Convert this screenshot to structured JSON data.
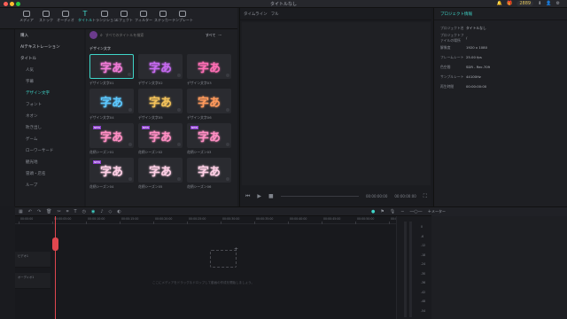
{
  "window": {
    "title": "タイトルなし"
  },
  "topbar_right": {
    "points": "2889",
    "items": [
      "🔔",
      "🎁",
      "⬇",
      "👤",
      "⚙"
    ]
  },
  "nav_tabs": [
    {
      "label": "メディア",
      "icon": "media-icon"
    },
    {
      "label": "ストック",
      "icon": "stock-icon"
    },
    {
      "label": "オーディオ",
      "icon": "audio-icon"
    },
    {
      "label": "タイトル",
      "icon": "title-icon",
      "active": true
    },
    {
      "label": "トランジション",
      "icon": "transition-icon"
    },
    {
      "label": "エフェクト",
      "icon": "effect-icon"
    },
    {
      "label": "フィルター",
      "icon": "filter-icon"
    },
    {
      "label": "ステッカー",
      "icon": "sticker-icon"
    },
    {
      "label": "テンプレート",
      "icon": "template-icon"
    }
  ],
  "sidebar": {
    "items": [
      {
        "label": "購入",
        "level": "top"
      },
      {
        "label": "AIテキストレーション",
        "level": "top"
      },
      {
        "label": "タイトル",
        "level": "top"
      },
      {
        "label": "人気",
        "level": "sub"
      },
      {
        "label": "字幕",
        "level": "sub"
      },
      {
        "label": "デザイン文字",
        "level": "sub",
        "active": true
      },
      {
        "label": "フォント",
        "level": "sub"
      },
      {
        "label": "ネオン",
        "level": "sub"
      },
      {
        "label": "吹き出し",
        "level": "sub"
      },
      {
        "label": "ゲーム",
        "level": "sub"
      },
      {
        "label": "ローワーサード",
        "level": "sub"
      },
      {
        "label": "観光地",
        "level": "sub"
      },
      {
        "label": "冒頭・店名",
        "level": "sub"
      },
      {
        "label": "ループ",
        "level": "sub"
      }
    ]
  },
  "gallery": {
    "search_placeholder": "すべてのタイトルを検索",
    "filter_label": "すべて",
    "more_label": "···",
    "section_title": "デザイン文字",
    "items": [
      {
        "glyph": "字あ",
        "color": "#f07bd6",
        "caption": "デザイン文字01",
        "selected": true
      },
      {
        "glyph": "字あ",
        "color": "#c66af0",
        "caption": "デザイン文字02"
      },
      {
        "glyph": "字あ",
        "color": "#ff6fb5",
        "caption": "デザイン文字03"
      },
      {
        "glyph": "字あ",
        "color": "#5cc8ff",
        "caption": "デザイン文字04"
      },
      {
        "glyph": "字あ",
        "color": "#f3c25a",
        "caption": "デザイン文字05"
      },
      {
        "glyph": "字あ",
        "color": "#ff9a5c",
        "caption": "デザイン文字06"
      },
      {
        "glyph": "字あ",
        "color": "#ff8fc4",
        "caption": "花柄シーズン01",
        "badge": "NEW"
      },
      {
        "glyph": "字あ",
        "color": "#ff8fc4",
        "caption": "花柄シーズン02",
        "badge": "NEW"
      },
      {
        "glyph": "字あ",
        "color": "#ff8fc4",
        "caption": "花柄シーズン03",
        "badge": "NEW"
      },
      {
        "glyph": "字あ",
        "color": "#ffd0e6",
        "caption": "花柄シーズン04",
        "badge": "NEW"
      },
      {
        "glyph": "字あ",
        "color": "#ffd0e6",
        "caption": "花柄シーズン05"
      },
      {
        "glyph": "字あ",
        "color": "#ffd0e6",
        "caption": "花柄シーズン06"
      }
    ]
  },
  "preview": {
    "tab_player": "タイムライン",
    "tab_quality": "フル",
    "time_current": "00:00:00:00",
    "time_total": "00:00:00:00"
  },
  "properties": {
    "tab": "プロジェクト情報",
    "rows": [
      {
        "k": "プロジェクト名",
        "v": "タイトルなし"
      },
      {
        "k": "プロジェクトファイルの場所",
        "v": "/"
      },
      {
        "k": "解像度",
        "v": "1920 x 1080"
      },
      {
        "k": "フレームレート",
        "v": "25.00 fps"
      },
      {
        "k": "色空間",
        "v": "SDR - Rec.709"
      },
      {
        "k": "サンプルレート",
        "v": "44100Hz"
      },
      {
        "k": "再生時間",
        "v": "00:00:00:00"
      }
    ]
  },
  "timeline_toolbar": {
    "meter_label": "メーター"
  },
  "timeline": {
    "ruler_ticks": [
      "00:00:00",
      "00:00:05:00",
      "00:00:10:00",
      "00:00:15:00",
      "00:00:20:00",
      "00:00:25:00",
      "00:00:30:00",
      "00:00:35:00",
      "00:00:40:00",
      "00:00:45:00",
      "00:00:50:00",
      "00:00:55:00"
    ],
    "tracks": [
      "ビデオ1",
      "オーディオ1"
    ],
    "drop_hint": "ここにメディアをドラッグ＆ドロップして動画の作成を開始しましょう。",
    "meter_db": [
      "0",
      "-6",
      "-12",
      "-18",
      "-24",
      "-30",
      "-36",
      "-42",
      "-48",
      "-54"
    ]
  },
  "colors": {
    "accent": "#3fd6c9",
    "playhead": "#e0474f"
  }
}
